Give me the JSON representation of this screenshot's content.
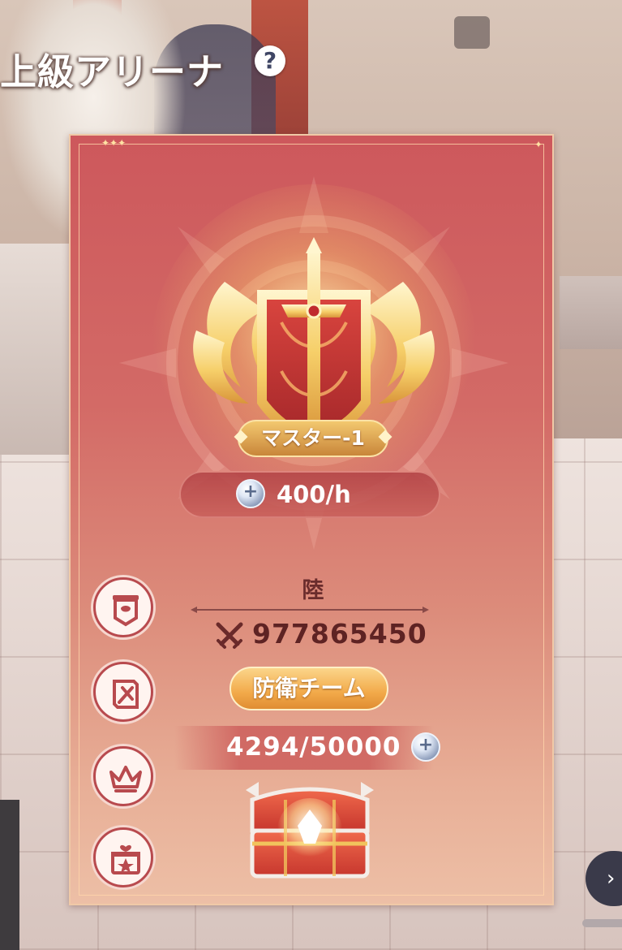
{
  "header": {
    "title": "上級アリーナ",
    "help_icon": "?"
  },
  "rank": {
    "name": "マスター-1",
    "emblem_icon": "flaming-sword-shield-emblem"
  },
  "income": {
    "rate": "400/h",
    "currency_icon": "silver-coin-icon"
  },
  "player": {
    "name": "陸",
    "power_icon": "crossed-swords-icon",
    "power": "977865450"
  },
  "defense_team_button": "防衛チーム",
  "reward": {
    "progress_text": "4294/50000",
    "current": 4294,
    "goal": 50000,
    "chest_icon": "treasure-chest-icon"
  },
  "side_menu": [
    {
      "name": "battle-banner-icon"
    },
    {
      "name": "battle-record-scroll-icon"
    },
    {
      "name": "ranking-crown-icon"
    },
    {
      "name": "gift-reward-icon"
    }
  ],
  "colors": {
    "card_top": "#cd585c",
    "card_bottom": "#edbfa6",
    "accent_gold": "#f2aa4a",
    "text_dark": "#5e2323"
  }
}
